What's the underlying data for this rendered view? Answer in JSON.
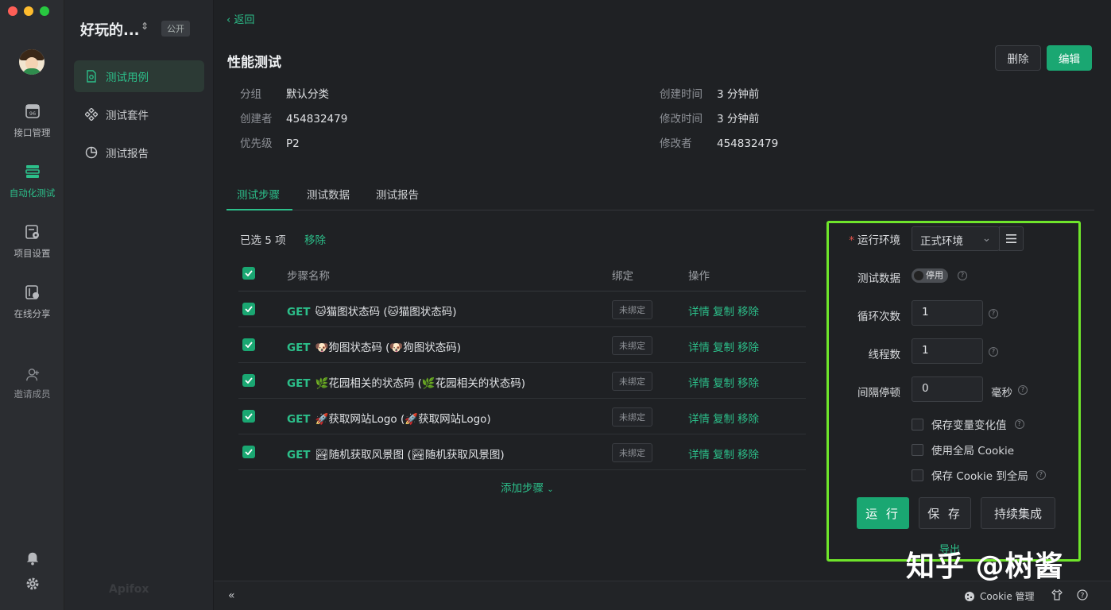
{
  "window": {
    "traffic_colors": [
      "#fe5f57",
      "#febc2e",
      "#28c840"
    ]
  },
  "rail": {
    "items": [
      {
        "label": "接口管理",
        "icon": "api-icon"
      },
      {
        "label": "自动化测试",
        "icon": "automation-icon",
        "active": true
      },
      {
        "label": "项目设置",
        "icon": "settings-doc-icon"
      },
      {
        "label": "在线分享",
        "icon": "share-icon"
      },
      {
        "label": "邀请成员",
        "icon": "invite-user-icon"
      }
    ]
  },
  "sidebar": {
    "project_title": "好玩的...",
    "visibility_badge": "公开",
    "items": [
      {
        "label": "测试用例",
        "active": true
      },
      {
        "label": "测试套件"
      },
      {
        "label": "测试报告"
      }
    ],
    "brand": "Apifox"
  },
  "header": {
    "back_label": "返回",
    "title": "性能测试",
    "delete_label": "删除",
    "edit_label": "编辑"
  },
  "meta": {
    "group_key": "分组",
    "group_val": "默认分类",
    "creator_key": "创建者",
    "creator_val": "454832479",
    "priority_key": "优先级",
    "priority_val": "P2",
    "created_key": "创建时间",
    "created_val": "3 分钟前",
    "modified_key": "修改时间",
    "modified_val": "3 分钟前",
    "modifier_key": "修改者",
    "modifier_val": "454832479"
  },
  "tabs": [
    "测试步骤",
    "测试数据",
    "测试报告"
  ],
  "steps": {
    "selected_text": "已选 5 项",
    "remove_label": "移除",
    "columns": {
      "name": "步骤名称",
      "bind": "绑定",
      "ops": "操作"
    },
    "rows": [
      {
        "method": "GET",
        "name": "🐱猫图状态码 (🐱猫图状态码)",
        "bind": "未绑定"
      },
      {
        "method": "GET",
        "name": "🐶狗图状态码 (🐶狗图状态码)",
        "bind": "未绑定"
      },
      {
        "method": "GET",
        "name": "🌿花园相关的状态码 (🌿花园相关的状态码)",
        "bind": "未绑定"
      },
      {
        "method": "GET",
        "name": "🚀获取网站Logo (🚀获取网站Logo)",
        "bind": "未绑定"
      },
      {
        "method": "GET",
        "name": "🏞随机获取风景图 (🏞随机获取风景图)",
        "bind": "未绑定"
      }
    ],
    "ops": {
      "detail": "详情",
      "copy": "复制",
      "remove": "移除"
    },
    "add_step_label": "添加步骤"
  },
  "run_panel": {
    "env_label": "运行环境",
    "env_value": "正式环境",
    "test_data_label": "测试数据",
    "test_data_toggle": "停用",
    "loops_label": "循环次数",
    "loops_value": "1",
    "threads_label": "线程数",
    "threads_value": "1",
    "interval_label": "间隔停顿",
    "interval_value": "0",
    "interval_unit": "毫秒",
    "check_save_vars": "保存变量变化值",
    "check_global_cookie": "使用全局 Cookie",
    "check_save_cookie": "保存 Cookie 到全局",
    "run_label": "运 行",
    "save_label": "保 存",
    "ci_label": "持续集成",
    "export_label": "导出"
  },
  "bottom": {
    "cookie_label": "Cookie 管理"
  },
  "watermark": "知乎 @树酱",
  "colors": {
    "accent": "#2cbf8a",
    "button": "#1aa772",
    "highlight_border": "#6fe52b"
  }
}
